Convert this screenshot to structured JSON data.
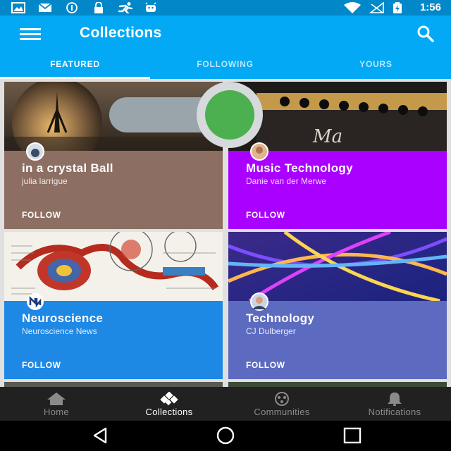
{
  "status_bar": {
    "time": "1:56",
    "icons": [
      "image-icon",
      "mail-icon",
      "registered-icon",
      "lock-icon",
      "runner-icon",
      "android-icon",
      "wifi-icon",
      "no-signal-icon",
      "battery-charging-icon"
    ]
  },
  "app_bar": {
    "title": "Collections",
    "menu_icon": "hamburger-menu-icon",
    "search_icon": "search-icon",
    "tabs": [
      {
        "label": "FEATURED",
        "active": true
      },
      {
        "label": "FOLLOWING",
        "active": false
      },
      {
        "label": "YOURS",
        "active": false
      }
    ]
  },
  "colors": {
    "status_bar": "#0288c9",
    "app_bar": "#03a9f4",
    "toggle_thumb": "#4caf50",
    "toggle_track": "#9aa5ab"
  },
  "toggle": {
    "on": true
  },
  "collections": [
    {
      "title": "in a crystal Ball",
      "owner": "julia larrigue",
      "follow_label": "FOLLOW",
      "color": "#8d6e63"
    },
    {
      "title": "Music Technology",
      "owner": "Danie van der Merwe",
      "follow_label": "FOLLOW",
      "color": "#aa00ff"
    },
    {
      "title": "Neuroscience",
      "owner": "Neuroscience News",
      "follow_label": "FOLLOW",
      "color": "#1e88e5"
    },
    {
      "title": "Technology",
      "owner": "CJ Dulberger",
      "follow_label": "FOLLOW",
      "color": "#5c6bc0"
    }
  ],
  "bottom_nav": [
    {
      "label": "Home",
      "icon": "home-icon",
      "active": false
    },
    {
      "label": "Collections",
      "icon": "collections-icon",
      "active": true
    },
    {
      "label": "Communities",
      "icon": "communities-icon",
      "active": false
    },
    {
      "label": "Notifications",
      "icon": "bell-icon",
      "active": false
    }
  ],
  "system_nav": [
    "back-icon",
    "home-circle-icon",
    "recents-icon"
  ]
}
